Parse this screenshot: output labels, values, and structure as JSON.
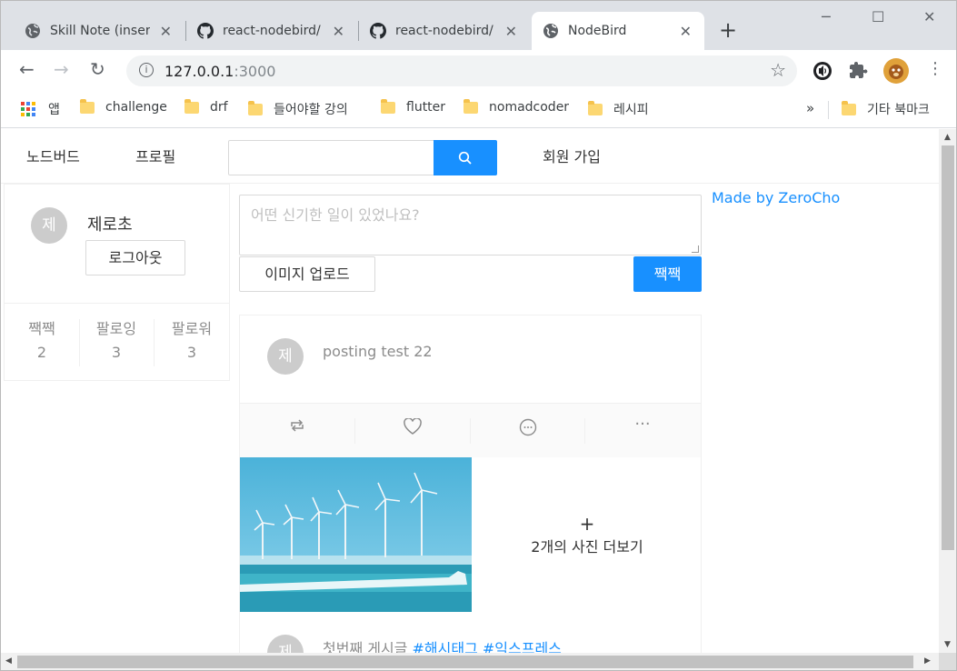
{
  "browser": {
    "tabs": [
      {
        "title": "Skill Note (inser",
        "icon": "globe-icon",
        "active": false
      },
      {
        "title": "react-nodebird/",
        "icon": "github-icon",
        "active": false
      },
      {
        "title": "react-nodebird/",
        "icon": "github-icon",
        "active": false
      },
      {
        "title": "NodeBird",
        "icon": "globe-icon",
        "active": true
      }
    ],
    "url_host": "127.0.0.1",
    "url_port": ":3000",
    "bookmarks": {
      "apps_label": "앱",
      "items": [
        "challenge",
        "drf",
        "들어야할 강의",
        "flutter",
        "nomadcoder",
        "레시피"
      ],
      "overflow": "»",
      "other": "기타 북마크"
    }
  },
  "nav": {
    "brand": "노드버드",
    "profile": "프로필",
    "search_placeholder": "",
    "signup": "회원 가입"
  },
  "user": {
    "avatar_initial": "제",
    "nickname": "제로초",
    "logout": "로그아웃",
    "stats": [
      {
        "label": "짹짹",
        "value": "2"
      },
      {
        "label": "팔로잉",
        "value": "3"
      },
      {
        "label": "팔로워",
        "value": "3"
      }
    ]
  },
  "post_form": {
    "placeholder": "어떤 신기한 일이 있었나요?",
    "upload_label": "이미지 업로드",
    "submit_label": "짹짹"
  },
  "posts": [
    {
      "avatar_initial": "제",
      "content": "posting test 22"
    },
    {
      "avatar_initial": "제",
      "content_prefix": "첫번째 게시글 ",
      "hashtags": "#해시태그 #익스프레스",
      "more_photos": "2개의 사진 더보기",
      "plus": "+"
    }
  ],
  "credit": "Made by ZeroCho",
  "colors": {
    "primary": "#1890ff",
    "avatar": "#cccccc",
    "border": "#f0f0f0"
  }
}
